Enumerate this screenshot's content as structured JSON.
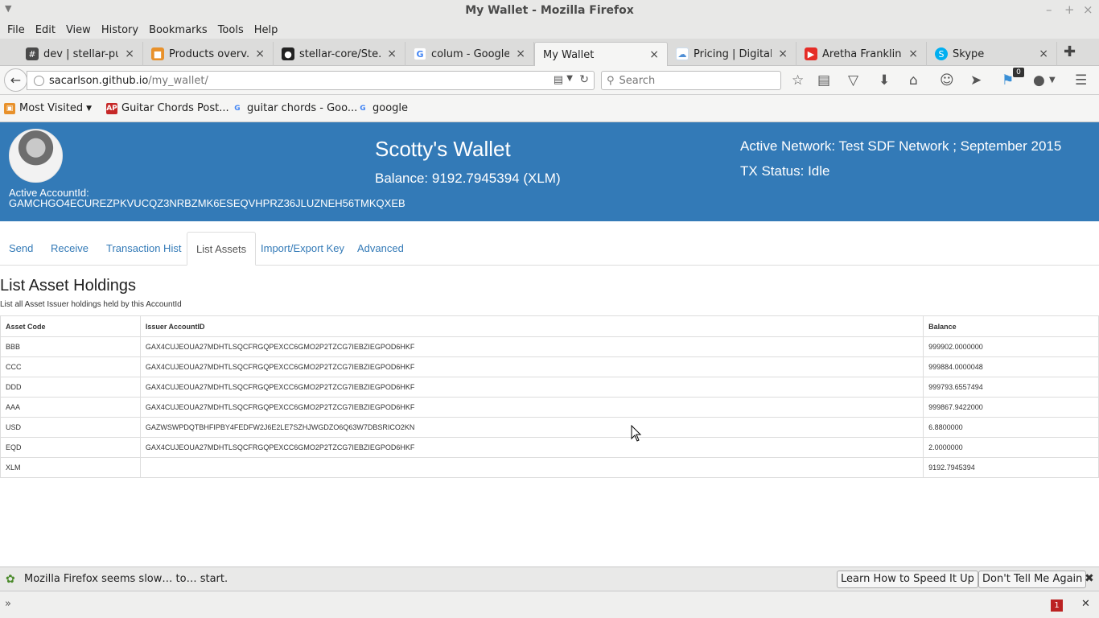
{
  "window": {
    "title": "My Wallet - Mozilla Firefox"
  },
  "menu": [
    "File",
    "Edit",
    "View",
    "History",
    "Bookmarks",
    "Tools",
    "Help"
  ],
  "tabs": [
    {
      "label": "dev | stellar-pu...",
      "icon": "hash-icon",
      "color": "#4a4a4a",
      "active": false
    },
    {
      "label": "Products overv...",
      "icon": "products-icon",
      "color": "#e8912b",
      "active": false
    },
    {
      "label": "stellar-core/Ste...",
      "icon": "github-icon",
      "color": "#222222",
      "active": false
    },
    {
      "label": "colum - Google...",
      "icon": "google-icon",
      "color": "#4285f4",
      "active": false
    },
    {
      "label": "My Wallet",
      "icon": "",
      "color": "",
      "active": true
    },
    {
      "label": "Pricing | Digital...",
      "icon": "cloud-icon",
      "color": "#4f8fd6",
      "active": false
    },
    {
      "label": "Aretha Franklin...",
      "icon": "youtube-icon",
      "color": "#e52d27",
      "active": false
    },
    {
      "label": "Skype",
      "icon": "skype-icon",
      "color": "#00aff0",
      "active": false
    }
  ],
  "nav": {
    "url_host": "sacarlson.github.io",
    "url_path": "/my_wallet/",
    "search_placeholder": "Search",
    "notification_count": "0"
  },
  "bookmarks": [
    {
      "label": "Most Visited",
      "icon": "most-visited-icon"
    },
    {
      "label": "Guitar Chords Post...",
      "icon": "ap-icon"
    },
    {
      "label": "guitar chords - Goo...",
      "icon": "google-icon"
    },
    {
      "label": "google",
      "icon": "google-icon"
    }
  ],
  "wallet": {
    "title": "Scotty's Wallet",
    "balance": "Balance: 9192.7945394 (XLM)",
    "account_label": "Active AccountId:",
    "account_id": "GAMCHGO4ECUREZPKVUCQZ3NRBZMK6ESEQVHPRZ36JLUZNEH56TMKQXEB",
    "network": "Active Network: Test SDF Network ; September 2015",
    "tx_status": "TX Status: Idle",
    "header_color": "#337ab7"
  },
  "page_tabs": [
    "Send",
    "Receive",
    "Transaction Hist",
    "List Assets",
    "Import/Export Key",
    "Advanced"
  ],
  "active_page_tab": "List Assets",
  "assets": {
    "title": "List Asset Holdings",
    "description": "List all Asset Issuer holdings held by this AccountId",
    "columns": [
      "Asset Code",
      "Issuer AccountID",
      "Balance"
    ],
    "rows": [
      [
        "BBB",
        "GAX4CUJEOUA27MDHTLSQCFRGQPEXCC6GMO2P2TZCG7IEBZIEGPOD6HKF",
        "999902.0000000"
      ],
      [
        "CCC",
        "GAX4CUJEOUA27MDHTLSQCFRGQPEXCC6GMO2P2TZCG7IEBZIEGPOD6HKF",
        "999884.0000048"
      ],
      [
        "DDD",
        "GAX4CUJEOUA27MDHTLSQCFRGQPEXCC6GMO2P2TZCG7IEBZIEGPOD6HKF",
        "999793.6557494"
      ],
      [
        "AAA",
        "GAX4CUJEOUA27MDHTLSQCFRGQPEXCC6GMO2P2TZCG7IEBZIEGPOD6HKF",
        "999867.9422000"
      ],
      [
        "USD",
        "GAZWSWPDQTBHFIPBY4FEDFW2J6E2LE7SZHJWGDZO6Q63W7DBSRICO2KN",
        "6.8800000"
      ],
      [
        "EQD",
        "GAX4CUJEOUA27MDHTLSQCFRGQPEXCC6GMO2P2TZCG7IEBZIEGPOD6HKF",
        "2.0000000"
      ],
      [
        "XLM",
        "",
        "9192.7945394"
      ]
    ]
  },
  "notification": {
    "message": "Mozilla Firefox seems slow… to… start.",
    "learn_button": "Learn How to Speed It Up",
    "dismiss_button": "Don't Tell Me Again"
  },
  "addon_bar": {
    "badge": "1"
  }
}
